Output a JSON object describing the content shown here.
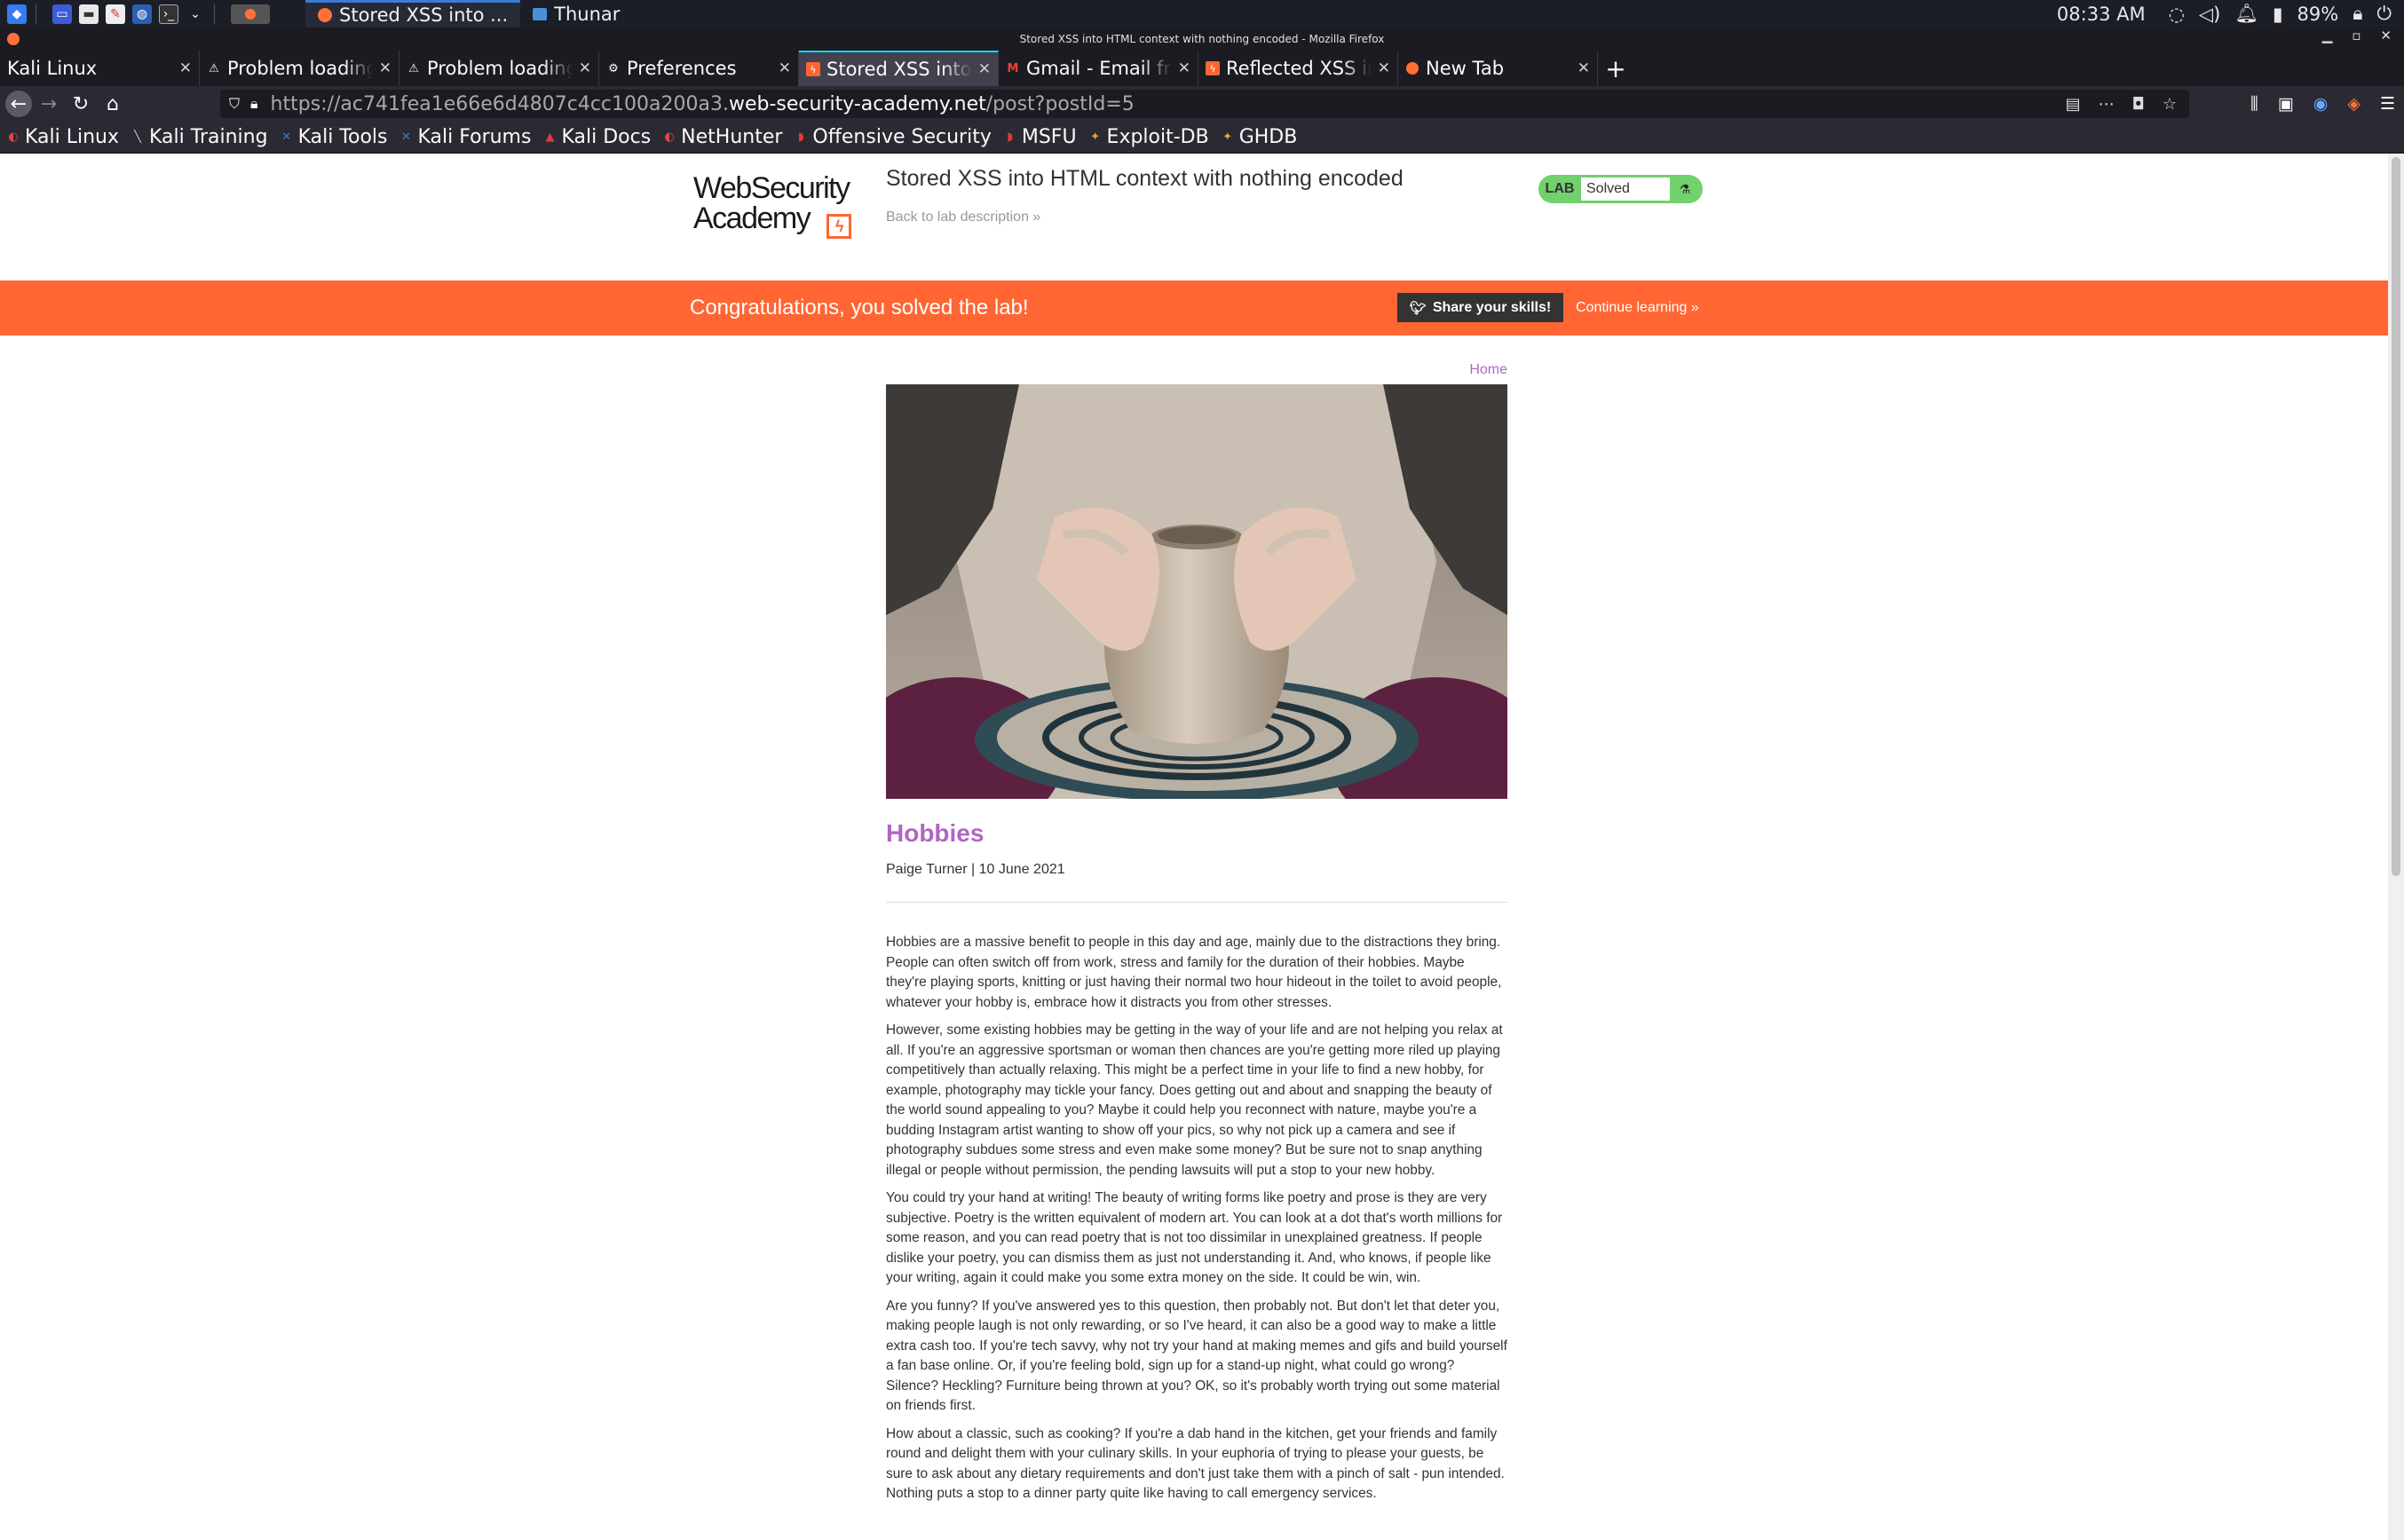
{
  "taskbar": {
    "tasks": [
      {
        "label": "Stored XSS into ...",
        "icon": "firefox-icon"
      },
      {
        "label": "Thunar",
        "icon": "folder-icon"
      }
    ],
    "clock": "08:33 AM",
    "battery": "89%"
  },
  "window": {
    "title": "Stored XSS into HTML context with nothing encoded - Mozilla Firefox"
  },
  "tabs": [
    {
      "label": "Kali Linux",
      "icon": "kali-icon",
      "active": false
    },
    {
      "label": "Problem loading page",
      "icon": "warning-icon",
      "active": false
    },
    {
      "label": "Problem loading page",
      "icon": "warning-icon",
      "active": false
    },
    {
      "label": "Preferences",
      "icon": "gear-icon",
      "active": false
    },
    {
      "label": "Stored XSS into HTML context",
      "icon": "portswigger-icon",
      "active": true
    },
    {
      "label": "Gmail - Email from Google",
      "icon": "gmail-icon",
      "active": false
    },
    {
      "label": "Reflected XSS into HTML",
      "icon": "portswigger-icon",
      "active": false
    },
    {
      "label": "New Tab",
      "icon": "firefox-icon",
      "active": false
    }
  ],
  "navbar": {
    "url_prefix": "https://ac741fea1e66e6d4807c4cc100a200a3.",
    "url_host": "web-security-academy.net",
    "url_path": "/post?postId=5"
  },
  "bookmarks": [
    {
      "label": "Kali Linux",
      "color": "#e7424a"
    },
    {
      "label": "Kali Training",
      "color": "#1a1a1a"
    },
    {
      "label": "Kali Tools",
      "color": "#2d7fd6"
    },
    {
      "label": "Kali Forums",
      "color": "#2d7fd6"
    },
    {
      "label": "Kali Docs",
      "color": "#e23a3a"
    },
    {
      "label": "NetHunter",
      "color": "#e7424a"
    },
    {
      "label": "Offensive Security",
      "color": "#e23a3a"
    },
    {
      "label": "MSFU",
      "color": "#e23a3a"
    },
    {
      "label": "Exploit-DB",
      "color": "#f0a030"
    },
    {
      "label": "GHDB",
      "color": "#f0a030"
    }
  ],
  "lab": {
    "logo_line1": "WebSecurity",
    "logo_line2": "Academy",
    "title": "Stored XSS into HTML context with nothing encoded",
    "back_link": "Back to lab description »",
    "status_pill": "LAB",
    "status": "Solved"
  },
  "banner": {
    "message": "Congratulations, you solved the lab!",
    "share": "Share your skills!",
    "continue": "Continue learning »"
  },
  "post": {
    "home_link": "Home",
    "title": "Hobbies",
    "byline": "Paige Turner | 10 June 2021",
    "paragraphs": [
      "Hobbies are a massive benefit to people in this day and age, mainly due to the distractions they bring. People can often switch off from work, stress and family for the duration of their hobbies. Maybe they're playing sports, knitting or just having their normal two hour hideout in the toilet to avoid people, whatever your hobby is, embrace how it distracts you from other stresses.",
      "However, some existing hobbies may be getting in the way of your life and are not helping you relax at all. If you're an aggressive sportsman or woman then chances are you're getting more riled up playing competitively than actually relaxing. This might be a perfect time in your life to find a new hobby, for example, photography may tickle your fancy. Does getting out and about and snapping the beauty of the world sound appealing to you? Maybe it could help you reconnect with nature, maybe you're a budding Instagram artist wanting to show off your pics, so why not pick up a camera and see if photography subdues some stress and even make some money? But be sure not to snap anything illegal or people without permission, the pending lawsuits will put a stop to your new hobby.",
      "You could try your hand at writing! The beauty of writing forms like poetry and prose is they are very subjective. Poetry is the written equivalent of modern art. You can look at a dot that's worth millions for some reason, and you can read poetry that is not too dissimilar in unexplained greatness. If people dislike your poetry, you can dismiss them as just not understanding it. And, who knows, if people like your writing, again it could make you some extra money on the side. It could be win, win.",
      "Are you funny? If you've answered yes to this question, then probably not. But don't let that deter you, making people laugh is not only rewarding, or so I've heard, it can also be a good way to make a little extra cash too. If you're tech savvy, why not try your hand at making memes and gifs and build yourself a fan base online. Or, if you're feeling bold, sign up for a stand-up night, what could go wrong? Silence? Heckling? Furniture being thrown at you? OK, so it's probably worth trying out some material on friends first.",
      "How about a classic, such as cooking? If you're a dab hand in the kitchen, get your friends and family round and delight them with your culinary skills. In your euphoria of trying to please your guests, be sure to ask about any dietary requirements and don't just take them with a pinch of salt - pun intended. Nothing puts a stop to a dinner party quite like having to call emergency services."
    ]
  },
  "colors": {
    "accent_orange": "#ff6633",
    "post_purple": "#b066c3",
    "solved_green": "#70d16d"
  }
}
